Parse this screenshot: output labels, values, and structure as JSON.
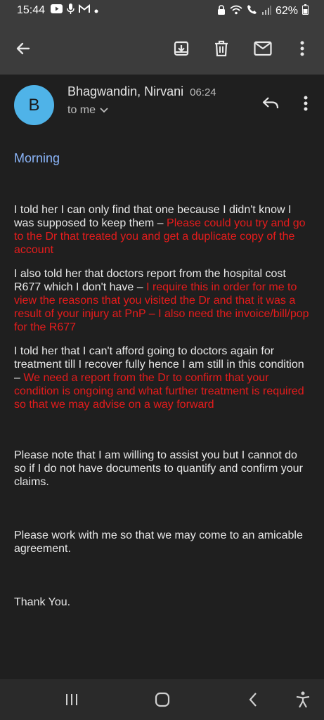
{
  "status_bar": {
    "time": "15:44",
    "battery": "62%"
  },
  "email": {
    "sender": "Bhagwandin, Nirvani",
    "time": "06:24",
    "recipient": "to me",
    "avatar_letter": "B",
    "avatar_color": "#4fb3e8",
    "greeting": "Morning",
    "paragraphs": [
      {
        "text": "I told her I can only find that one because I didn't know I was supposed to keep them – ",
        "reply": "Please could you try and go to the Dr that treated you and get a duplicate copy of the account"
      },
      {
        "text": "I also told her that doctors report from the hospital cost R677 which I don't have – ",
        "reply": "I require this in order for me to view the reasons that you visited the Dr and that it was a result of your injury at PnP – I also need the invoice/bill/pop for the R677"
      },
      {
        "text": "I told her that I can't afford going to doctors again for treatment till I recover fully hence I am still in this condition – ",
        "reply": "We need a report from the Dr to confirm that your condition is ongoing and what further treatment is required so that we may advise on a way forward"
      }
    ],
    "note": "Please note that I am willing to assist you but I cannot do so if I do not have documents to quantify and confirm your claims.",
    "request": "Please work with me so that we may come to an amicable agreement.",
    "closing": "Thank You."
  },
  "colors": {
    "reply_red": "#e51c1c",
    "greeting_blue": "#8ab4f8"
  }
}
